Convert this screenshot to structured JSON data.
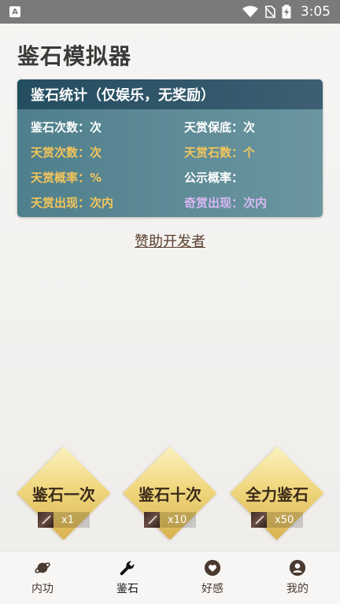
{
  "status_bar": {
    "time": "3:05",
    "app_icon": "A"
  },
  "page": {
    "title": "鉴石模拟器"
  },
  "stats": {
    "header": "鉴石统计（仅娱乐，无奖励）",
    "items": [
      {
        "label": "鉴石次数：次",
        "color": "#ffffff"
      },
      {
        "label": "天赏保底：次",
        "color": "#ffffff"
      },
      {
        "label": "天赏次数：次",
        "color": "#f3c55a"
      },
      {
        "label": "天赏石数：个",
        "color": "#f3c55a"
      },
      {
        "label": "天赏概率：%",
        "color": "#f3c55a"
      },
      {
        "label": "公示概率：",
        "color": "#ffffff"
      },
      {
        "label": "天赏出现：次内",
        "color": "#f3c55a"
      },
      {
        "label": "奇赏出现：次内",
        "color": "#d8b8f4"
      }
    ]
  },
  "sponsor_link": "赞助开发者",
  "actions": [
    {
      "label": "鉴石一次",
      "cost": "x1",
      "icon": "brush-item-icon"
    },
    {
      "label": "鉴石十次",
      "cost": "x10",
      "icon": "brush-item-icon"
    },
    {
      "label": "全力鉴石",
      "cost": "x50",
      "icon": "brush-item-icon"
    }
  ],
  "nav": {
    "active": "鉴石",
    "items": [
      {
        "label": "内功",
        "icon": "planet-icon"
      },
      {
        "label": "鉴石",
        "icon": "wrench-icon"
      },
      {
        "label": "好感",
        "icon": "heart-icon"
      },
      {
        "label": "我的",
        "icon": "user-icon"
      }
    ]
  },
  "colors": {
    "accent_gold": "#f3c55a",
    "card_bg": "#5f8c97",
    "card_header": "#2d5567"
  }
}
